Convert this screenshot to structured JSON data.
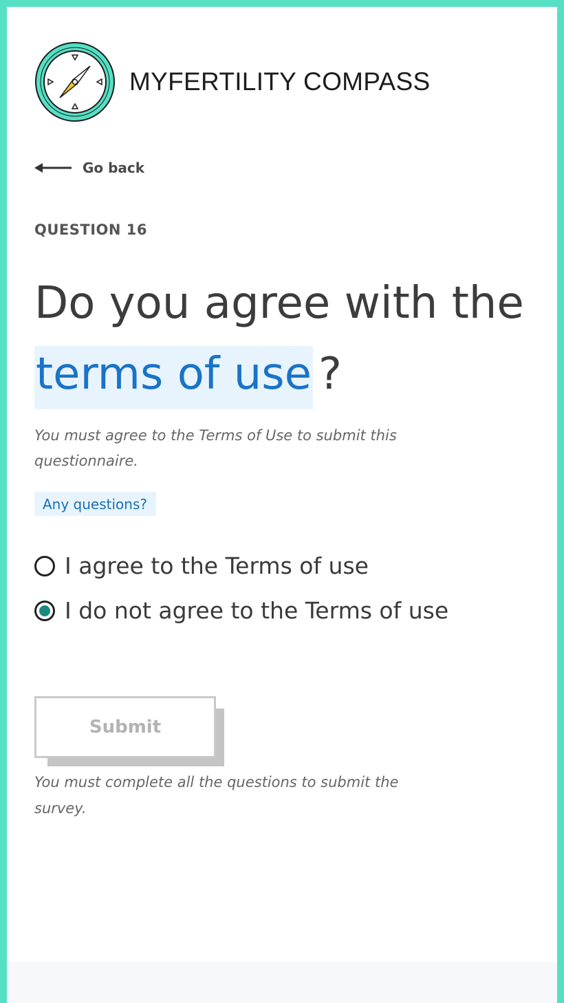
{
  "header": {
    "brand_name": "MYFERTILITY COMPASS",
    "logo_icon": "compass-icon"
  },
  "nav": {
    "back_label": "Go back",
    "back_icon": "arrow-left-icon"
  },
  "question": {
    "number_label": "QUESTION 16",
    "title_prefix": "Do you agree with the",
    "title_highlight": "terms of use",
    "title_suffix": "?",
    "helper": "You must agree to the Terms of Use to submit this questionnaire.",
    "help_link": "Any questions?",
    "options": [
      {
        "label": "I agree to the Terms of use",
        "selected": false
      },
      {
        "label": "I do not agree to the Terms of use",
        "selected": true
      }
    ]
  },
  "form": {
    "submit_label": "Submit",
    "submit_disabled": true,
    "note": "You must complete all the questions to submit the survey."
  },
  "colors": {
    "frame": "#55e0c4",
    "accent_teal": "#1a8a80",
    "link_blue": "#1a73c8",
    "highlight_bg": "#e8f4fd"
  }
}
